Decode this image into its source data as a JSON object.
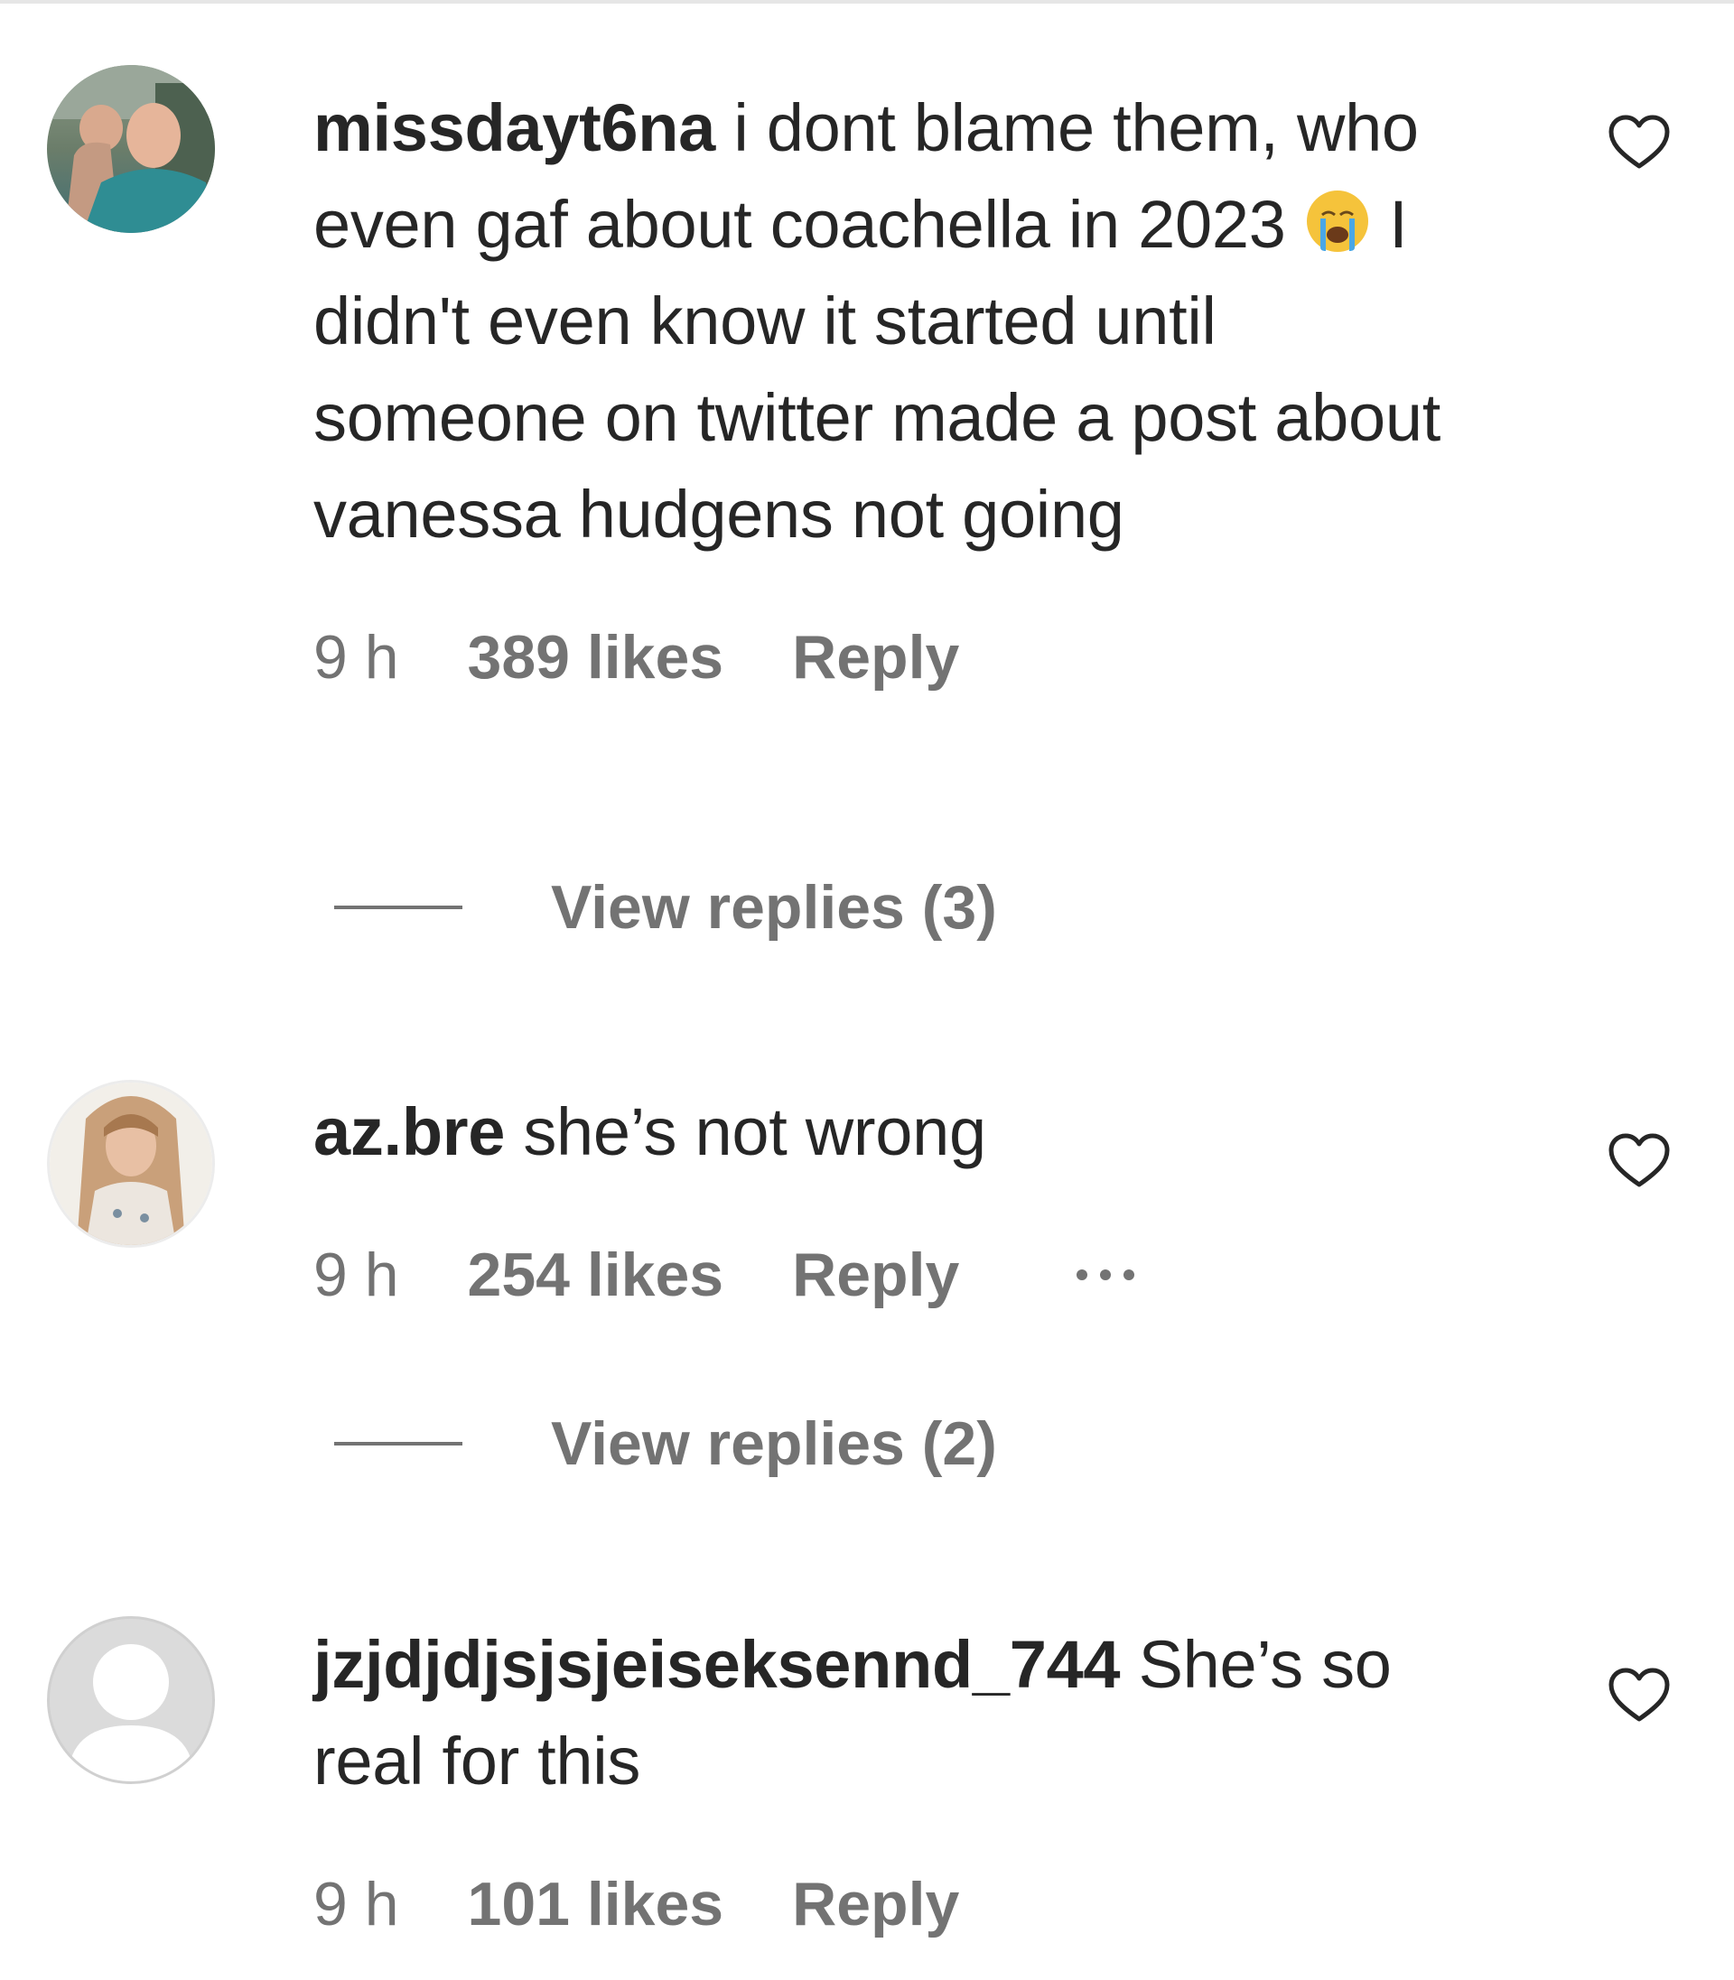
{
  "comments": [
    {
      "username": "missdayt6na",
      "text_before_emoji": "i dont blame them, who even gaf about coachella in 2023",
      "emoji": "loudly-crying-face",
      "text_after_emoji": "I didn't even know it started until someone on twitter made a post about vanessa hudgens not going",
      "time": "9 h",
      "likes": "389 likes",
      "reply_label": "Reply",
      "view_replies": "View replies (3)",
      "avatar_icon": "profile-photo-man-with-child",
      "like_icon": "heart-outline-icon"
    },
    {
      "username": "az.bre",
      "text": "she’s not wrong",
      "time": "9 h",
      "likes": "254 likes",
      "reply_label": "Reply",
      "more_icon": "more-options-icon",
      "view_replies": "View replies (2)",
      "avatar_icon": "profile-photo-woman",
      "like_icon": "heart-outline-icon"
    },
    {
      "username": "jzjdjdjsjsjeiseksennd_744",
      "text": "She’s so real for this",
      "time": "9 h",
      "likes": "101 likes",
      "reply_label": "Reply",
      "avatar_icon": "default-avatar-icon",
      "like_icon": "heart-outline-icon"
    }
  ],
  "colors": {
    "primary_text": "#262626",
    "secondary_text": "#737373",
    "default_avatar_bg": "#dbdbdb"
  }
}
